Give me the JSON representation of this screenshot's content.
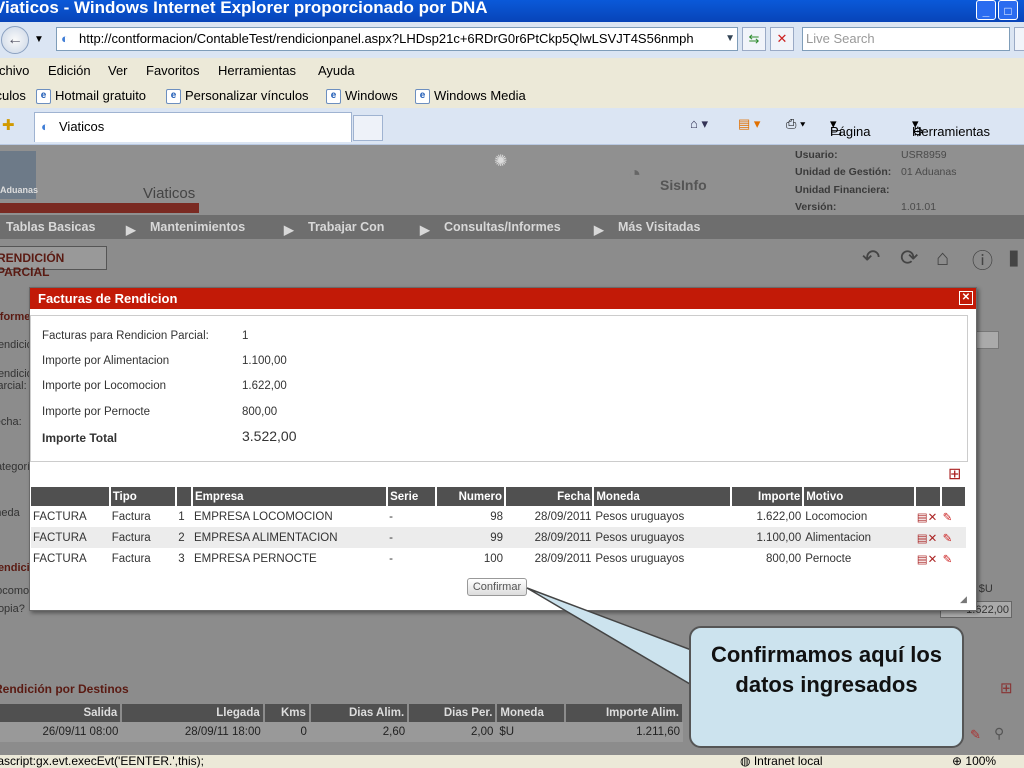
{
  "window": {
    "title": "Viaticos - Windows Internet Explorer proporcionado por DNA",
    "minimize": "_",
    "maximize": "□"
  },
  "address": {
    "url": "http://contformacion/ContableTest/rendicionpanel.aspx?LHDsp21c+6RDrG0r6PtCkp5QlwLSVJT4S56nmph",
    "search_placeholder": "Live Search"
  },
  "menu": [
    "Archivo",
    "Edición",
    "Ver",
    "Favoritos",
    "Herramientas",
    "Ayuda"
  ],
  "links": {
    "label": "Vínculos",
    "items": [
      "Hotmail gratuito",
      "Personalizar vínculos",
      "Windows",
      "Windows Media"
    ]
  },
  "tab": {
    "label": "Viaticos"
  },
  "command_bar": {
    "page": "Página",
    "tools": "Herramientas"
  },
  "app": {
    "logo_text": "Aduanas",
    "module_title": "Viaticos",
    "brand": "SisInfo",
    "user_info": {
      "usuario_label": "Usuario:",
      "usuario_value": "USR8959",
      "unidad_gestion_label": "Unidad de Gestión:",
      "unidad_gestion_value": "01 Aduanas",
      "unidad_financiera_label": "Unidad Financiera:",
      "unidad_financiera_value": "",
      "version_label": "Versión:",
      "version_value": "1.01.01"
    },
    "nav": [
      "Tablas Basicas",
      "Mantenimientos",
      "Trabajar Con",
      "Consultas/Informes",
      "Más Visitadas"
    ],
    "page_heading": "RENDICIÓN PARCIAL",
    "side_labels": [
      "Informe",
      "Rendición",
      "Rendición Parcial:",
      "Fecha:",
      "Categoría",
      "Moneda",
      "Rendición",
      "Locomoción",
      "Copia?"
    ],
    "bottom_section_title": "Rendición por Destinos",
    "bottom_right_label": "ión: $U",
    "bottom_right_value": "1.622,00",
    "bottom_table": {
      "headers": [
        "Salida",
        "Llegada",
        "Kms",
        "Dias Alim.",
        "Dias Per.",
        "Moneda",
        "Importe Alim."
      ],
      "row": [
        "26/09/11 08:00",
        "28/09/11 18:00",
        "0",
        "2,60",
        "2,00",
        "$U",
        "1.211,60"
      ]
    }
  },
  "dialog": {
    "title": "Facturas de Rendicion",
    "summary": [
      {
        "label": "Facturas para Rendicion Parcial:",
        "value": "1"
      },
      {
        "label": "Importe por Alimentacion",
        "value": "1.100,00"
      },
      {
        "label": "Importe por Locomocion",
        "value": "1.622,00"
      },
      {
        "label": "Importe por Pernocte",
        "value": "800,00"
      }
    ],
    "total": {
      "label": "Importe Total",
      "value": "3.522,00"
    },
    "table": {
      "headers": [
        "",
        "Tipo",
        "",
        "Empresa",
        "Serie",
        "Numero",
        "Fecha",
        "Moneda",
        "Importe",
        "Motivo",
        "",
        ""
      ],
      "rows": [
        [
          "FACTURA",
          "Factura",
          "1",
          "EMPRESA LOCOMOCION",
          "-",
          "98",
          "28/09/2011",
          "Pesos uruguayos",
          "1.622,00",
          "Locomocion"
        ],
        [
          "FACTURA",
          "Factura",
          "2",
          "EMPRESA ALIMENTACION",
          "-",
          "99",
          "28/09/2011",
          "Pesos uruguayos",
          "1.100,00",
          "Alimentacion"
        ],
        [
          "FACTURA",
          "Factura",
          "3",
          "EMPRESA PERNOCTE",
          "-",
          "100",
          "28/09/2011",
          "Pesos uruguayos",
          "800,00",
          "Pernocte"
        ]
      ]
    },
    "confirm_label": "Confirmar"
  },
  "callout": {
    "text": "Confirmamos aquí los datos ingresados"
  },
  "status": {
    "script": "javascript:gx.evt.execEvt('EENTER.',this);",
    "zone": "Intranet local",
    "zoom": "100%"
  }
}
